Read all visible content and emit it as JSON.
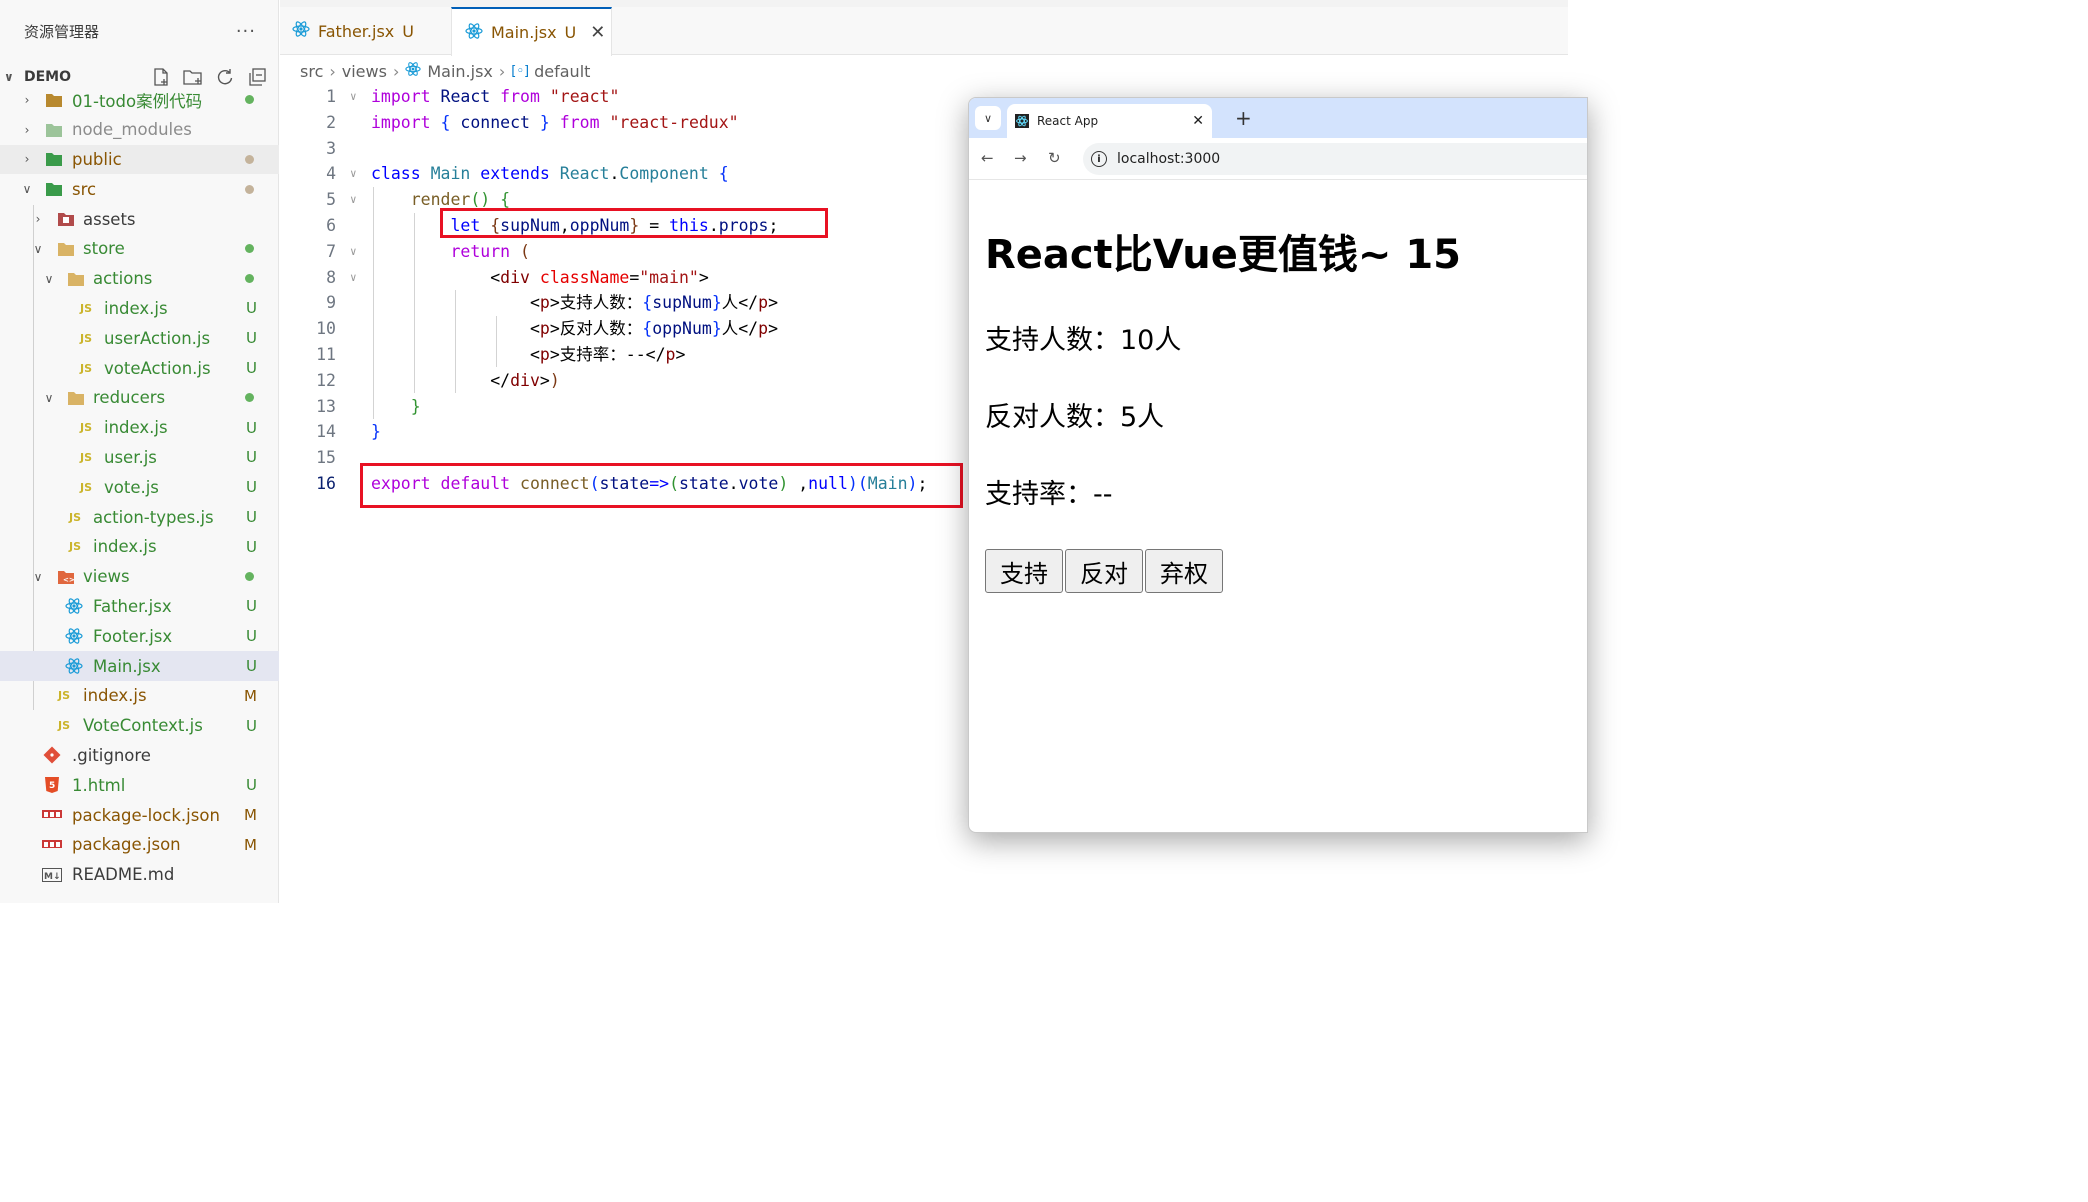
{
  "explorer": {
    "title": "资源管理器",
    "more": "···",
    "workspace": "DEMO",
    "items": [
      {
        "label": "01-todo案例代码",
        "status": "dot",
        "color": "#388a34"
      },
      {
        "label": "node_modules",
        "status": "",
        "color": "#8c8c8c"
      },
      {
        "label": "public",
        "status": "dot",
        "color": "#b0b0b0"
      },
      {
        "label": "src",
        "status": "dot",
        "color": "#b0b0b0"
      },
      {
        "label": "assets",
        "status": "",
        "color": "#3b3b3b"
      },
      {
        "label": "store",
        "status": "dot",
        "color": "#388a34"
      },
      {
        "label": "actions",
        "status": "dot",
        "color": "#388a34"
      },
      {
        "label": "index.js",
        "status": "U",
        "color": "#388a34"
      },
      {
        "label": "userAction.js",
        "status": "U",
        "color": "#388a34"
      },
      {
        "label": "voteAction.js",
        "status": "U",
        "color": "#388a34"
      },
      {
        "label": "reducers",
        "status": "dot",
        "color": "#388a34"
      },
      {
        "label": "index.js",
        "status": "U",
        "color": "#388a34"
      },
      {
        "label": "user.js",
        "status": "U",
        "color": "#388a34"
      },
      {
        "label": "vote.js",
        "status": "U",
        "color": "#388a34"
      },
      {
        "label": "action-types.js",
        "status": "U",
        "color": "#388a34"
      },
      {
        "label": "index.js",
        "status": "U",
        "color": "#388a34"
      },
      {
        "label": "views",
        "status": "dot",
        "color": "#388a34"
      },
      {
        "label": "Father.jsx",
        "status": "U",
        "color": "#388a34"
      },
      {
        "label": "Footer.jsx",
        "status": "U",
        "color": "#388a34"
      },
      {
        "label": "Main.jsx",
        "status": "U",
        "color": "#388a34"
      },
      {
        "label": "index.js",
        "status": "M",
        "color": "#895503"
      },
      {
        "label": "VoteContext.js",
        "status": "U",
        "color": "#388a34"
      },
      {
        "label": ".gitignore",
        "status": "",
        "color": "#3b3b3b"
      },
      {
        "label": "1.html",
        "status": "U",
        "color": "#388a34"
      },
      {
        "label": "package-lock.json",
        "status": "M",
        "color": "#895503"
      },
      {
        "label": "package.json",
        "status": "M",
        "color": "#895503"
      },
      {
        "label": "README.md",
        "status": "",
        "color": "#3b3b3b"
      }
    ]
  },
  "tabs": [
    {
      "label": "Father.jsx",
      "status": "U"
    },
    {
      "label": "Main.jsx",
      "status": "U",
      "close": "✕"
    }
  ],
  "breadcrumb": [
    "src",
    "views",
    "Main.jsx",
    "default"
  ],
  "code": {
    "line_numbers": [
      "1",
      "2",
      "3",
      "4",
      "5",
      "6",
      "7",
      "8",
      "9",
      "10",
      "11",
      "12",
      "13",
      "14",
      "15",
      "16"
    ]
  },
  "browser": {
    "tab_title": "React App",
    "tab_close": "✕",
    "new_tab": "+",
    "url": "localhost:3000",
    "heading": "React比Vue更值钱~ 15",
    "support_text": "支持人数：10人",
    "oppose_text": "反对人数：5人",
    "rate_text": "支持率：--",
    "buttons": [
      "支持",
      "反对",
      "弃权"
    ]
  }
}
